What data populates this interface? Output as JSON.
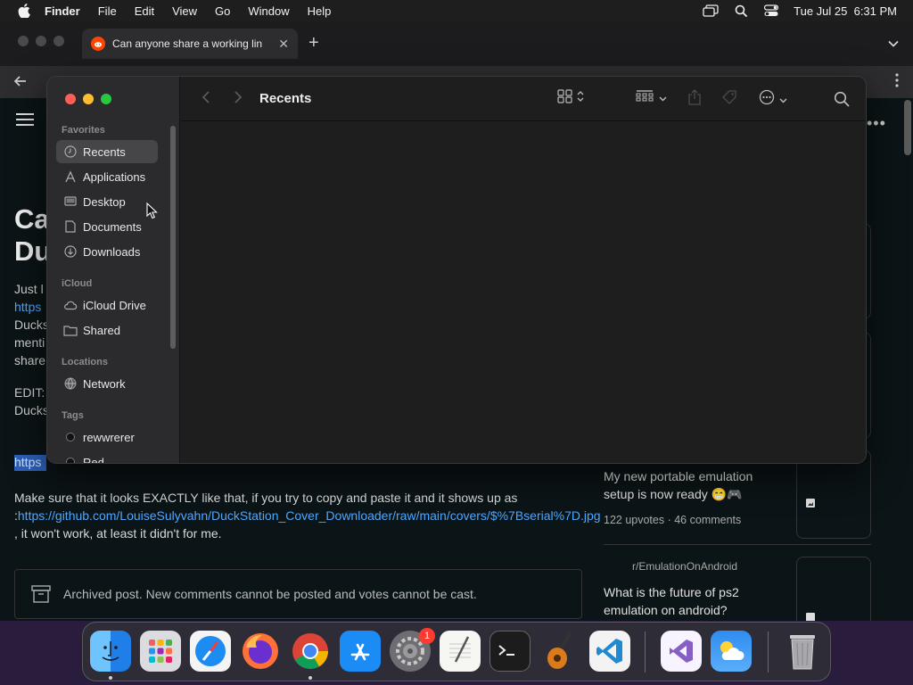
{
  "menubar": {
    "app_name": "Finder",
    "items": [
      "File",
      "Edit",
      "View",
      "Go",
      "Window",
      "Help"
    ],
    "clock": "Tue Jul 25  6:31 PM"
  },
  "browser": {
    "tab_title": "Can anyone share a working lin",
    "post": {
      "title_fragment_1": "Ca",
      "title_fragment_2": "Du",
      "body_fragments": [
        "Just l",
        "https",
        "Ducks",
        "menti",
        "share",
        "EDIT:",
        "Ducks"
      ],
      "highlighted_fragment": "https",
      "paragraph_before_link": "Make sure that it looks EXACTLY like that, if you try to copy and paste it and it shows up as :",
      "paragraph_link": "https://github.com/LouiseSulyvahn/DuckStation_Cover_Downloader/raw/main/covers/$%7Bserial%7D.jpg",
      "paragraph_after_link": " , it won't work, at least it didn't for me.",
      "archived_notice": "Archived post. New comments cannot be posted and votes cannot be cast."
    },
    "related": [
      {
        "subreddit": "",
        "title": "My new portable emulation setup is now ready 😁🎮",
        "upvotes": "122 upvotes",
        "comments": "46 comments"
      },
      {
        "subreddit": "r/EmulationOnAndroid",
        "title": "What is the future of ps2 emulation on android?",
        "upvotes": "",
        "comments": ""
      }
    ]
  },
  "finder": {
    "title": "Recents",
    "sections": {
      "favorites": "Favorites",
      "icloud": "iCloud",
      "locations": "Locations",
      "tags": "Tags"
    },
    "favorites": [
      {
        "label": "Recents",
        "icon": "clock-icon"
      },
      {
        "label": "Applications",
        "icon": "applications-icon"
      },
      {
        "label": "Desktop",
        "icon": "desktop-icon"
      },
      {
        "label": "Documents",
        "icon": "document-icon"
      },
      {
        "label": "Downloads",
        "icon": "download-icon"
      }
    ],
    "icloud": [
      {
        "label": "iCloud Drive",
        "icon": "cloud-icon"
      },
      {
        "label": "Shared",
        "icon": "shared-folder-icon"
      }
    ],
    "locations": [
      {
        "label": "Network",
        "icon": "globe-icon"
      }
    ],
    "tags": [
      {
        "label": "rewwrerer",
        "color": "#111111"
      },
      {
        "label": "Red",
        "color": "#111111"
      }
    ]
  },
  "dock": {
    "apps": [
      "Finder",
      "Launchpad",
      "Safari",
      "Firefox",
      "Chrome",
      "App Store",
      "System Settings",
      "TextEdit",
      "Terminal",
      "GarageBand",
      "Visual Studio Code",
      "Visual Studio",
      "Weather",
      "Trash"
    ],
    "settings_badge": "1"
  },
  "colors": {
    "finder_sidebar": "#2b2b2d",
    "finder_main": "#1e1e1e",
    "link": "#4fa7ff",
    "close": "#ff5f57",
    "minimize": "#febc2e",
    "maximize": "#28c840"
  }
}
